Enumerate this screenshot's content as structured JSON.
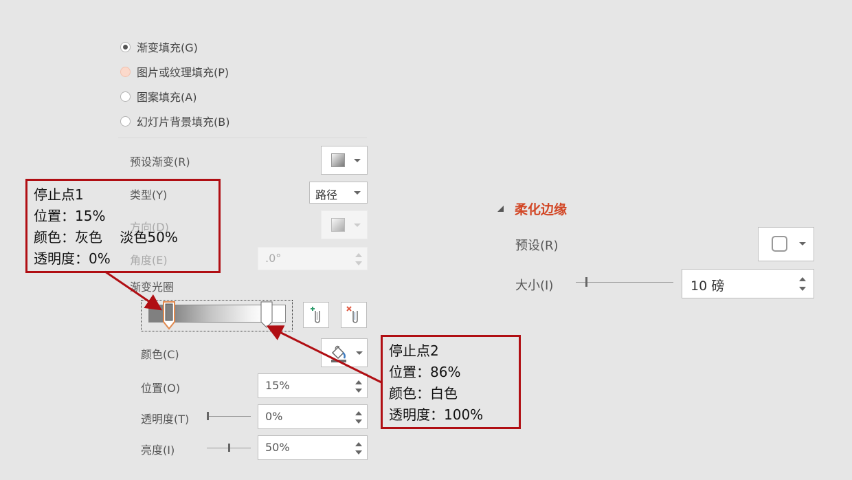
{
  "fill_options": [
    {
      "label": "渐变填充(G)",
      "selected": true
    },
    {
      "label": "图片或纹理填充(P)",
      "selected": false,
      "hovered": true
    },
    {
      "label": "图案填充(A)",
      "selected": false
    },
    {
      "label": "幻灯片背景填充(B)",
      "selected": false
    }
  ],
  "gradient": {
    "preset_label": "预设渐变(R)",
    "type_label": "类型(Y)",
    "type_value": "路径",
    "direction_label": "方向(D)",
    "angle_label": "角度(E)",
    "angle_value": ".0°",
    "stops_label": "渐变光圈",
    "stops": [
      {
        "position": 15,
        "selected": true
      },
      {
        "position": 86,
        "selected": false
      }
    ],
    "add_stop_icon": "add-gradient-stop-icon",
    "remove_stop_icon": "remove-gradient-stop-icon",
    "color_label": "颜色(C)",
    "color_icon": "paint-bucket-icon",
    "position_label": "位置(O)",
    "position_value": "15%",
    "transparency_label": "透明度(T)",
    "transparency_value": "0%",
    "transparency_slider": 0,
    "brightness_label": "亮度(I)",
    "brightness_value": "50%",
    "brightness_slider": 50
  },
  "soft_edges": {
    "title": "柔化边缘",
    "title_color": "#d24726",
    "preset_label": "预设(R)",
    "size_label": "大小(I)",
    "size_value": "10 磅",
    "size_slider": 10
  },
  "callouts": {
    "stop1": [
      "停止点1",
      "位置：15%",
      "颜色：灰色    淡色50%",
      "透明度：0%"
    ],
    "stop2": [
      "停止点2",
      "位置：86%",
      "颜色：白色",
      "透明度：100%"
    ],
    "color": "#b00e13"
  }
}
